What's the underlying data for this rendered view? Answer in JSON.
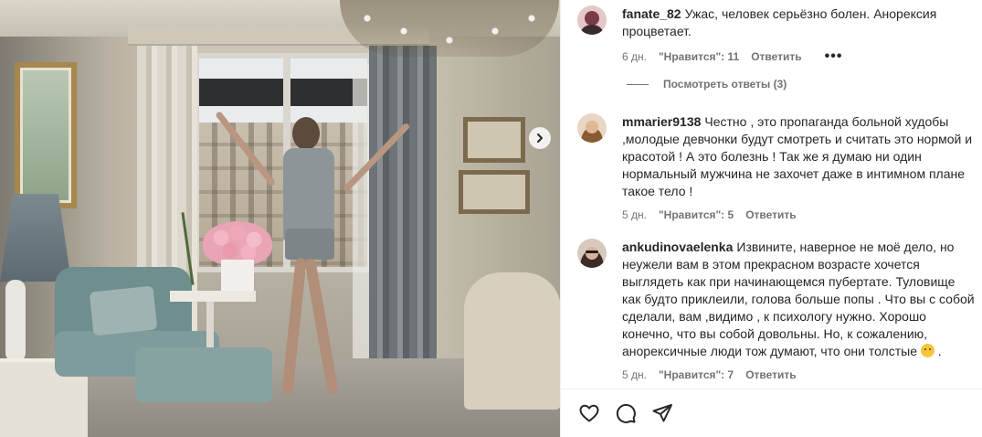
{
  "post": {
    "next_icon": "chevron-right-icon"
  },
  "comments": [
    {
      "username": "fanate_82",
      "text": "Ужас, человек серьёзно болен. Анорексия процветает.",
      "time": "6 дн.",
      "likes": "\"Нравится\": 11",
      "reply": "Ответить",
      "more_icon": "more-horizontal-icon",
      "more": "•••",
      "avatar_color": "#7b3a4a"
    },
    {
      "username": "mmarier9138",
      "text": "Честно , это пропаганда больной худобы ,молодые девчонки будут смотреть и считать это нормой и красотой ! А это болезнь ! Так же я думаю ни один нормальный мужчина не захочет даже в интимном плане такое тело !",
      "time": "5 дн.",
      "likes": "\"Нравится\": 5",
      "reply": "Ответить",
      "avatar_color": "#c9a27a"
    },
    {
      "username": "ankudinovaelenka",
      "text": "Извините, наверное не моё дело, но неужели вам в этом прекрасном возрасте хочется выглядеть как при начинающемся пубертате. Туловище как будто приклеили, голова больше попы . Что вы с собой сделали, вам ,видимо , к психологу нужно. Хорошо конечно, что вы собой довольны. Но, к сожалению, анорексичные люди тож думают, что они толстые",
      "emoji": "sad-face-emoji",
      "text_end": " .",
      "time": "5 дн.",
      "likes": "\"Нравится\": 7",
      "reply": "Ответить",
      "avatar_color": "#5a4a44"
    }
  ],
  "view_replies": "Посмотреть ответы (3)",
  "actions": {
    "like_icon": "heart-icon",
    "comment_icon": "comment-bubble-icon",
    "share_icon": "paper-plane-icon"
  },
  "colors": {
    "text": "#262626",
    "meta": "#737373",
    "divider": "#efefef"
  }
}
